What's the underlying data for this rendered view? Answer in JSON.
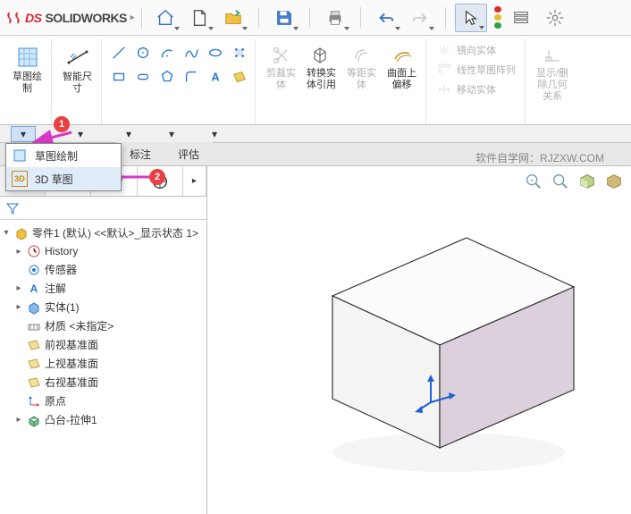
{
  "app": {
    "brand_ds": "DS",
    "brand_sw": "SOLIDWORKS"
  },
  "ribbon": {
    "sketch": "草图绘\n制",
    "smart_dim": "智能尺\n寸",
    "trim": "剪裁实\n体",
    "convert": "转换实\n体引用",
    "offset_dist": "等距实\n体",
    "surface_offset": "曲面上\n偏移",
    "mirror": "镜向实体",
    "linear_pattern": "线性草图阵列",
    "move": "移动实体",
    "display": "显示/删\n除几何\n关系"
  },
  "tabs": {
    "annotate": "标注",
    "evaluate": "评估"
  },
  "watermark": "软件自学网：RJZXW.COM",
  "menu": {
    "item1": "草图绘制",
    "item2": "3D 草图",
    "item2_prefix": "3D"
  },
  "badges": {
    "one": "1",
    "two": "2"
  },
  "tree": {
    "root": "零件1 (默认) <<默认>_显示状态 1>",
    "history": "History",
    "sensors": "传感器",
    "annotations": "注解",
    "solid": "实体(1)",
    "material": "材质 <未指定>",
    "front": "前视基准面",
    "top": "上视基准面",
    "right": "右视基准面",
    "origin": "原点",
    "extrude": "凸台-拉伸1"
  }
}
